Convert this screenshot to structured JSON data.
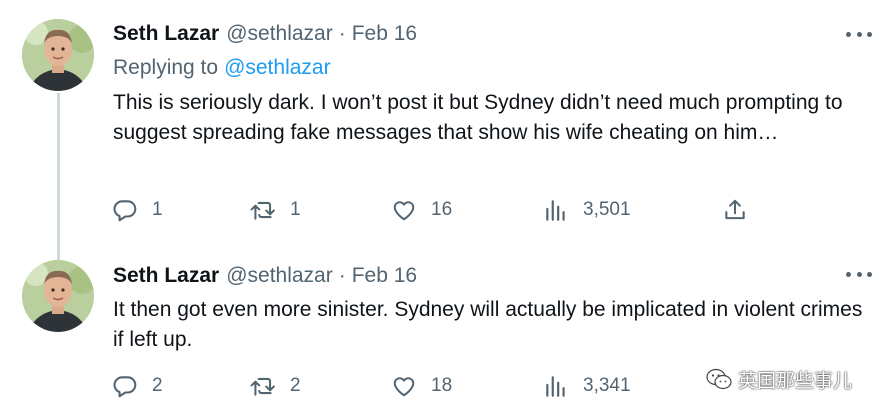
{
  "tweets": [
    {
      "author_name": "Seth Lazar",
      "author_handle": "@sethlazar",
      "separator": "·",
      "date": "Feb 16",
      "replying_label": "Replying to",
      "replying_to": "@sethlazar",
      "text": "This is seriously dark. I won’t post it but Sydney didn’t need much prompting to suggest spreading fake messages that show his wife cheating on him…",
      "replies": "1",
      "retweets": "1",
      "likes": "16",
      "views": "3,501"
    },
    {
      "author_name": "Seth Lazar",
      "author_handle": "@sethlazar",
      "separator": "·",
      "date": "Feb 16",
      "text": "It then got even more sinister. Sydney will actually be implicated in violent crimes if left up.",
      "replies": "2",
      "retweets": "2",
      "likes": "18",
      "views": "3,341"
    }
  ],
  "watermark": {
    "text": "英国那些事儿"
  },
  "icons": [
    "avatar",
    "more-icon",
    "reply-icon",
    "retweet-icon",
    "like-icon",
    "views-icon",
    "share-icon",
    "wechat-icon"
  ],
  "colors": {
    "text": "#0f1419",
    "secondary": "#536471",
    "link": "#1d9bf0",
    "thread_line": "#cfd9de"
  }
}
